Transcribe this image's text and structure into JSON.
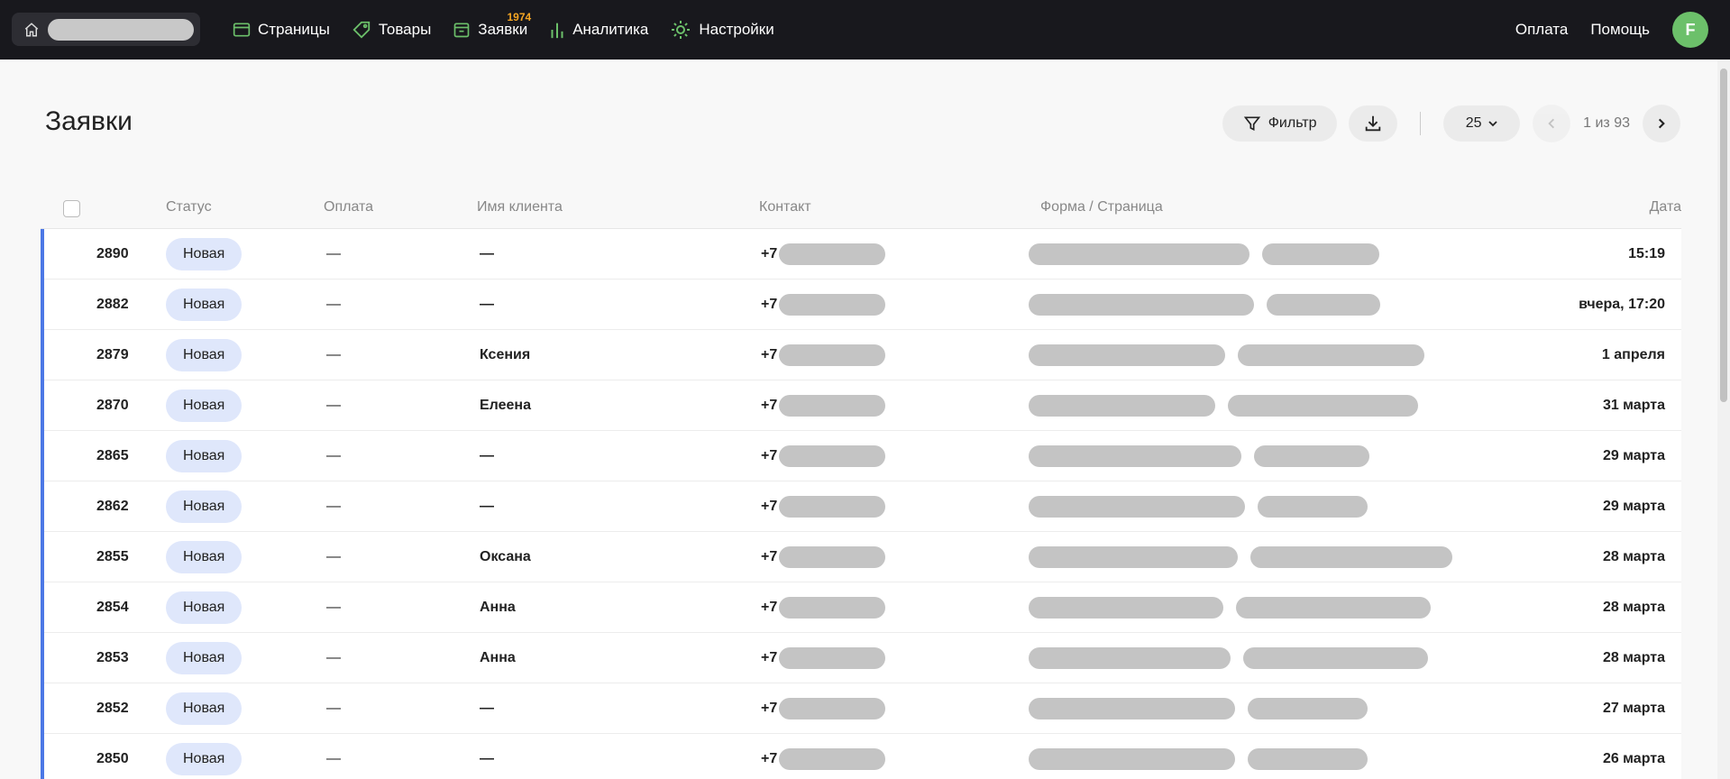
{
  "topbar": {
    "nav": [
      {
        "label": "Страницы",
        "icon": "browser-window-icon"
      },
      {
        "label": "Товары",
        "icon": "tag-icon"
      },
      {
        "label": "Заявки",
        "icon": "inbox-icon",
        "badge": "1974"
      },
      {
        "label": "Аналитика",
        "icon": "bar-chart-icon"
      },
      {
        "label": "Настройки",
        "icon": "gear-icon"
      }
    ],
    "payment": "Оплата",
    "help": "Помощь",
    "avatar_letter": "F",
    "accent_color": "#6cc06a",
    "badge_color": "#f5a623"
  },
  "page": {
    "title": "Заявки",
    "filter_label": "Фильтр",
    "per_page": "25",
    "page_info": "1 из 93"
  },
  "table": {
    "headers": {
      "status": "Статус",
      "payment": "Оплата",
      "client": "Имя клиента",
      "contact": "Контакт",
      "form": "Форма / Страница",
      "date": "Дата"
    },
    "rows": [
      {
        "id": "2890",
        "status": "Новая",
        "payment": "—",
        "name": "—",
        "contact": "+7",
        "date": "15:19"
      },
      {
        "id": "2882",
        "status": "Новая",
        "payment": "—",
        "name": "—",
        "contact": "+7",
        "date": "вчера, 17:20"
      },
      {
        "id": "2879",
        "status": "Новая",
        "payment": "—",
        "name": "Ксения",
        "contact": "+7",
        "date": "1 апреля"
      },
      {
        "id": "2870",
        "status": "Новая",
        "payment": "—",
        "name": "Елеена",
        "contact": "+7",
        "date": "31 марта"
      },
      {
        "id": "2865",
        "status": "Новая",
        "payment": "—",
        "name": "—",
        "contact": "+7",
        "date": "29 марта"
      },
      {
        "id": "2862",
        "status": "Новая",
        "payment": "—",
        "name": "—",
        "contact": "+7",
        "date": "29 марта"
      },
      {
        "id": "2855",
        "status": "Новая",
        "payment": "—",
        "name": "Оксана",
        "contact": "+7",
        "date": "28 марта"
      },
      {
        "id": "2854",
        "status": "Новая",
        "payment": "—",
        "name": "Анна",
        "contact": "+7",
        "date": "28 марта"
      },
      {
        "id": "2853",
        "status": "Новая",
        "payment": "—",
        "name": "Анна",
        "contact": "+7",
        "date": "28 марта"
      },
      {
        "id": "2852",
        "status": "Новая",
        "payment": "—",
        "name": "—",
        "contact": "+7",
        "date": "27 марта"
      },
      {
        "id": "2850",
        "status": "Новая",
        "payment": "—",
        "name": "—",
        "contact": "+7",
        "date": "26 марта"
      }
    ],
    "status_color": "#dfe7fb",
    "row_accent_color": "#4c78e6"
  }
}
